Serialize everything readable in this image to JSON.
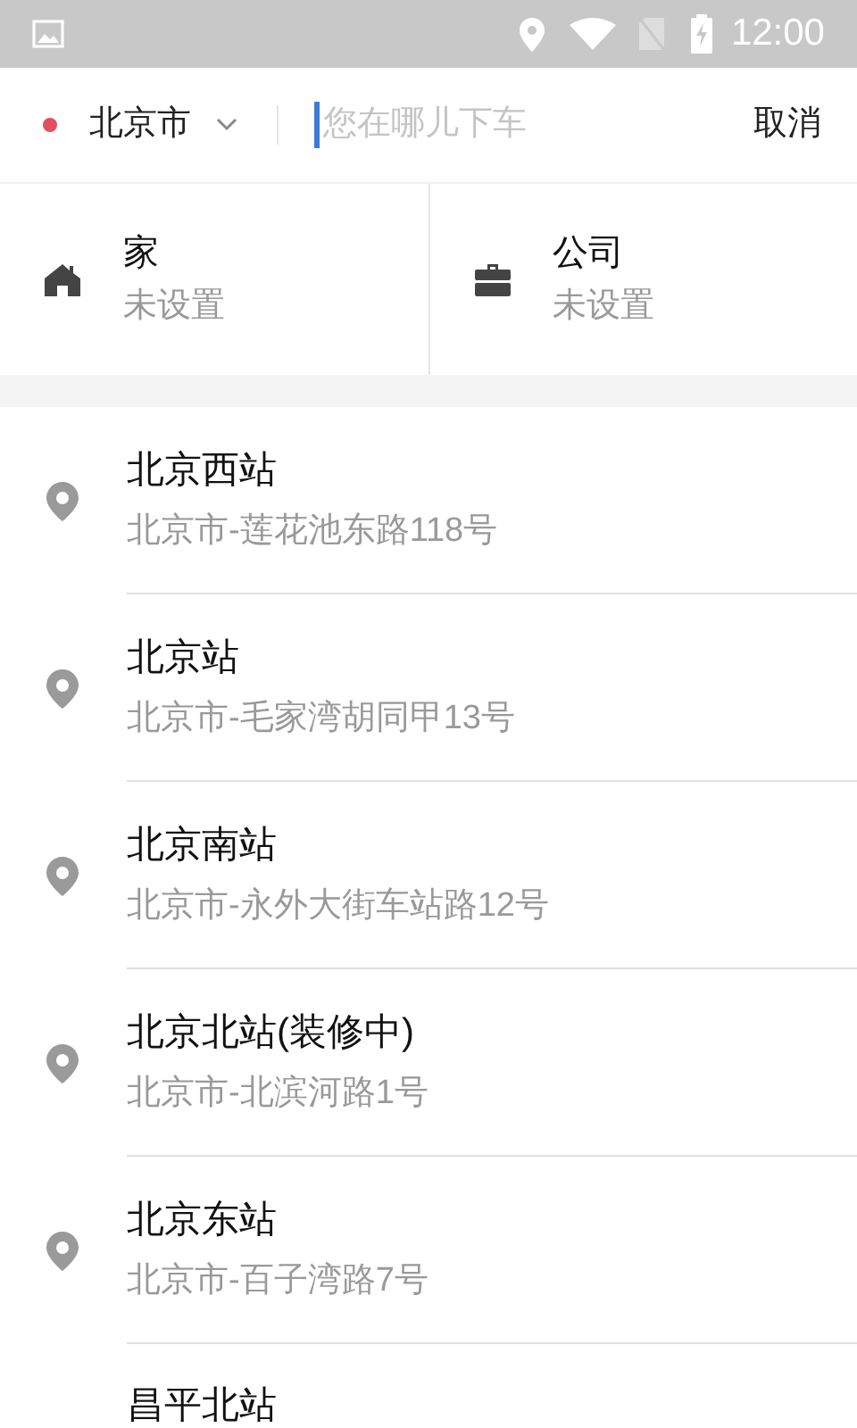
{
  "status_bar": {
    "time": "12:00"
  },
  "search": {
    "city": "北京市",
    "placeholder": "您在哪儿下车",
    "cancel": "取消"
  },
  "shortcuts": [
    {
      "kind": "home",
      "title": "家",
      "subtitle": "未设置"
    },
    {
      "kind": "work",
      "title": "公司",
      "subtitle": "未设置"
    }
  ],
  "places": [
    {
      "name": "北京西站",
      "address": "北京市-莲花池东路118号"
    },
    {
      "name": "北京站",
      "address": "北京市-毛家湾胡同甲13号"
    },
    {
      "name": "北京南站",
      "address": "北京市-永外大街车站路12号"
    },
    {
      "name": "北京北站(装修中)",
      "address": "北京市-北滨河路1号"
    },
    {
      "name": "北京东站",
      "address": "北京市-百子湾路7号"
    },
    {
      "name": "昌平北站"
    }
  ]
}
